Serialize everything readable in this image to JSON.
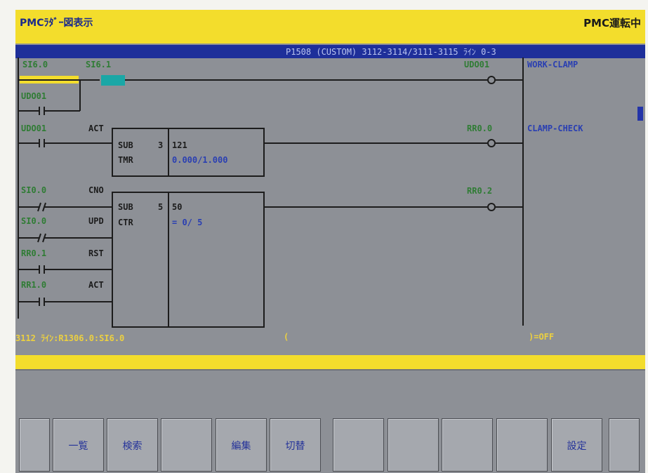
{
  "header": {
    "title": "PMCﾗﾀﾞｰ図表示",
    "status": "PMC運転中"
  },
  "info_bar": {
    "text": "P1508 (CUSTOM) 3112-3114/3111-3115 ﾗｲﾝ 0-3"
  },
  "rungs": {
    "r1": {
      "contact1": "SI6.0",
      "contact2": "SI6.1",
      "parallel": "UDO01",
      "coil": "UDO01",
      "comment": "WORK-CLAMP"
    },
    "r2": {
      "contact": "UDO01",
      "input_label": "ACT",
      "func": "SUB",
      "num": "3",
      "param": "121",
      "type": "TMR",
      "value": "0.000/1.000",
      "coil": "RR0.0",
      "comment": "CLAMP-CHECK"
    },
    "r3": {
      "func": "SUB",
      "num": "5",
      "param": "50",
      "type": "CTR",
      "count": "= 0/ 5",
      "coil": "RR0.2",
      "inputs": [
        {
          "contact": "SI0.0",
          "label": "CNO"
        },
        {
          "contact": "SI0.0",
          "label": "UPD"
        },
        {
          "contact": "RR0.1",
          "label": "RST"
        },
        {
          "contact": "RR1.0",
          "label": "ACT"
        }
      ]
    }
  },
  "message": {
    "left": "3112 ﾗｲﾝ:R1306.0:SI6.0",
    "mid": "(",
    "right": ")=OFF"
  },
  "softkeys": [
    "",
    "一覧",
    "検索",
    "",
    "編集",
    "切替",
    "",
    "",
    "",
    "",
    "設定",
    ""
  ],
  "colors": {
    "frame_yellow": "#f3dd2c",
    "screen_gray": "#8d9096",
    "address_green": "#2f7c34",
    "comment_blue": "#2a3fb2",
    "highlight": "#1aa7a6"
  }
}
